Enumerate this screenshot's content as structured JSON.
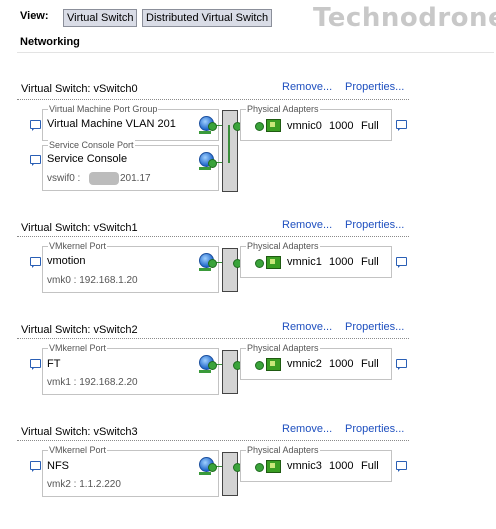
{
  "toolbar": {
    "view_label": "View:",
    "virtual_switch_label": "Virtual Switch",
    "distributed_switch_label": "Distributed Virtual Switch"
  },
  "watermark": "Technodrone",
  "section_title": "Networking",
  "links": {
    "remove": "Remove...",
    "properties": "Properties..."
  },
  "switches": [
    {
      "title": "Virtual Switch: vSwitch0",
      "port_groups": [
        {
          "legend": "Virtual Machine Port Group",
          "name": "Virtual Machine VLAN 201",
          "sub": ""
        },
        {
          "legend": "Service Console Port",
          "name": "Service Console",
          "sub_prefix": "vswif0 :",
          "sub": "201.17"
        }
      ],
      "adapters": {
        "legend": "Physical Adapters",
        "nic": "vmnic0",
        "speed": "1000",
        "duplex": "Full"
      }
    },
    {
      "title": "Virtual Switch: vSwitch1",
      "port_groups": [
        {
          "legend": "VMkernel Port",
          "name": "vmotion",
          "sub": "vmk0 : 192.168.1.20"
        }
      ],
      "adapters": {
        "legend": "Physical Adapters",
        "nic": "vmnic1",
        "speed": "1000",
        "duplex": "Full"
      }
    },
    {
      "title": "Virtual Switch: vSwitch2",
      "port_groups": [
        {
          "legend": "VMkernel Port",
          "name": "FT",
          "sub": "vmk1 : 192.168.2.20"
        }
      ],
      "adapters": {
        "legend": "Physical Adapters",
        "nic": "vmnic2",
        "speed": "1000",
        "duplex": "Full"
      }
    },
    {
      "title": "Virtual Switch: vSwitch3",
      "port_groups": [
        {
          "legend": "VMkernel Port",
          "name": "NFS",
          "sub": "vmk2 : 1.1.2.220"
        }
      ],
      "adapters": {
        "legend": "Physical Adapters",
        "nic": "vmnic3",
        "speed": "1000",
        "duplex": "Full"
      }
    }
  ],
  "colors": {
    "link": "#1e4fbf",
    "accent_green": "#3aa33a",
    "button_bg": "#d9dce6"
  },
  "icons": [
    "speech-bubble-icon",
    "globe-icon",
    "network-adapter-icon"
  ]
}
